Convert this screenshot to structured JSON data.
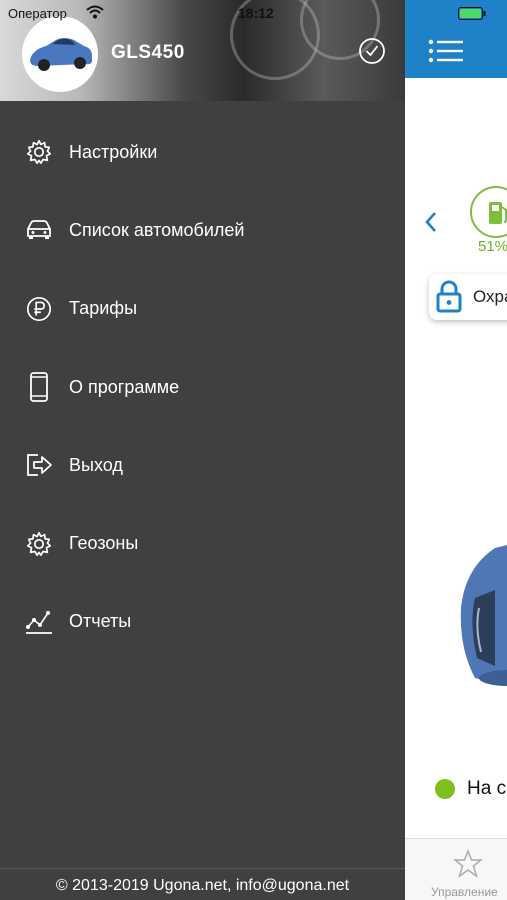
{
  "status_bar": {
    "carrier": "Оператор",
    "time": "18:12"
  },
  "drawer": {
    "car_name": "GLS450",
    "menu": [
      {
        "label": "Настройки",
        "icon": "gear-icon"
      },
      {
        "label": "Список автомобилей",
        "icon": "car-icon"
      },
      {
        "label": "Тарифы",
        "icon": "ruble-icon"
      },
      {
        "label": "О программе",
        "icon": "phone-icon"
      },
      {
        "label": "Выход",
        "icon": "exit-icon"
      },
      {
        "label": "Геозоны",
        "icon": "gear-icon"
      },
      {
        "label": "Отчеты",
        "icon": "chart-icon"
      }
    ],
    "footer": "© 2013-2019 Ugona.net, info@ugona.net"
  },
  "main": {
    "fuel_percent": "51%",
    "guard_label": "Охра",
    "status_label": "На с",
    "tab_label": "Управление"
  },
  "colors": {
    "drawer_bg": "#404040",
    "topbar_blue": "#1f82c9",
    "accent_green": "#7cbf1f"
  }
}
